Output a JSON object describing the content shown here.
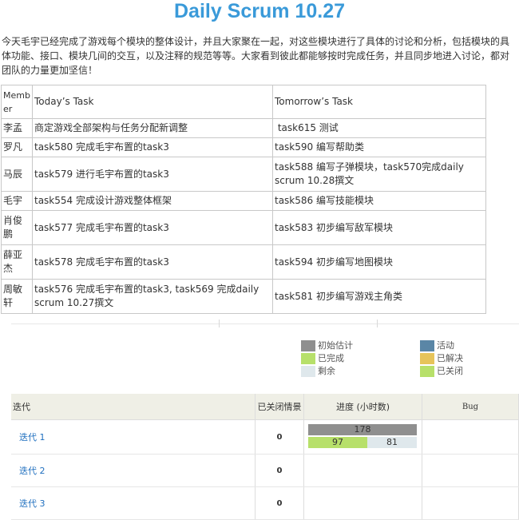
{
  "title": "Daily Scrum 10.27",
  "intro": "今天毛宇已经完成了游戏每个模块的整体设计，并且大家聚在一起，对这些模块进行了具体的讨论和分析，包括模块的具体功能、接口、模块几间的交互，以及注释的规范等等。大家看到彼此都能够按时完成任务，并且同步地进入讨论，都对团队的力量更加坚信！",
  "scrum_table": {
    "headers": [
      "Member",
      "Today’s Task",
      "Tomorrow’s Task"
    ],
    "rows": [
      {
        "member": "李孟",
        "today": "商定游戏全部架构与任务分配新调整",
        "tomorrow": " task615 测试"
      },
      {
        "member": "罗凡",
        "today": "task580 完成毛宇布置的task3",
        "tomorrow": "task590 编写帮助类"
      },
      {
        "member": "马辰",
        "today": "task579 进行毛宇布置的task3",
        "tomorrow": "task588 编写子弹模块，task570完成daily scrum 10.28撰文"
      },
      {
        "member": "毛宇",
        "today": "task554 完成设计游戏整体框架",
        "tomorrow": "task586 编写技能模块"
      },
      {
        "member": "肖俊鹏",
        "today": "task577 完成毛宇布置的task3",
        "tomorrow": "task583 初步编写敌军模块"
      },
      {
        "member": "薛亚杰",
        "today": "task578 完成毛宇布置的task3",
        "tomorrow": "task594 初步编写地图模块"
      },
      {
        "member": "周敏轩",
        "today": "task576 完成毛宇布置的task3, task569 完成daily scrum 10.27撰文",
        "tomorrow": "task581 初步编写游戏主角类"
      }
    ]
  },
  "legend": {
    "left": [
      {
        "label": "初始估计",
        "color": "#8f8f8f"
      },
      {
        "label": "已完成",
        "color": "#b7e06a"
      },
      {
        "label": "剩余",
        "color": "#dfe8ec"
      }
    ],
    "right": [
      {
        "label": "活动",
        "color": "#5a86a6"
      },
      {
        "label": "已解决",
        "color": "#e6c45a"
      },
      {
        "label": "已关闭",
        "color": "#b7e06a"
      }
    ]
  },
  "iteration_table": {
    "headers": {
      "iteration": "迭代",
      "closed": "已关闭情景",
      "progress": "进度 (小时数)",
      "bug": "Bug"
    },
    "rows": [
      {
        "name": "迭代 1",
        "closed": "0",
        "progress": {
          "estimate": 178,
          "completed": 97,
          "remaining": 81
        }
      },
      {
        "name": "迭代 2",
        "closed": "0",
        "progress": null
      },
      {
        "name": "迭代 3",
        "closed": "0",
        "progress": null
      }
    ]
  }
}
